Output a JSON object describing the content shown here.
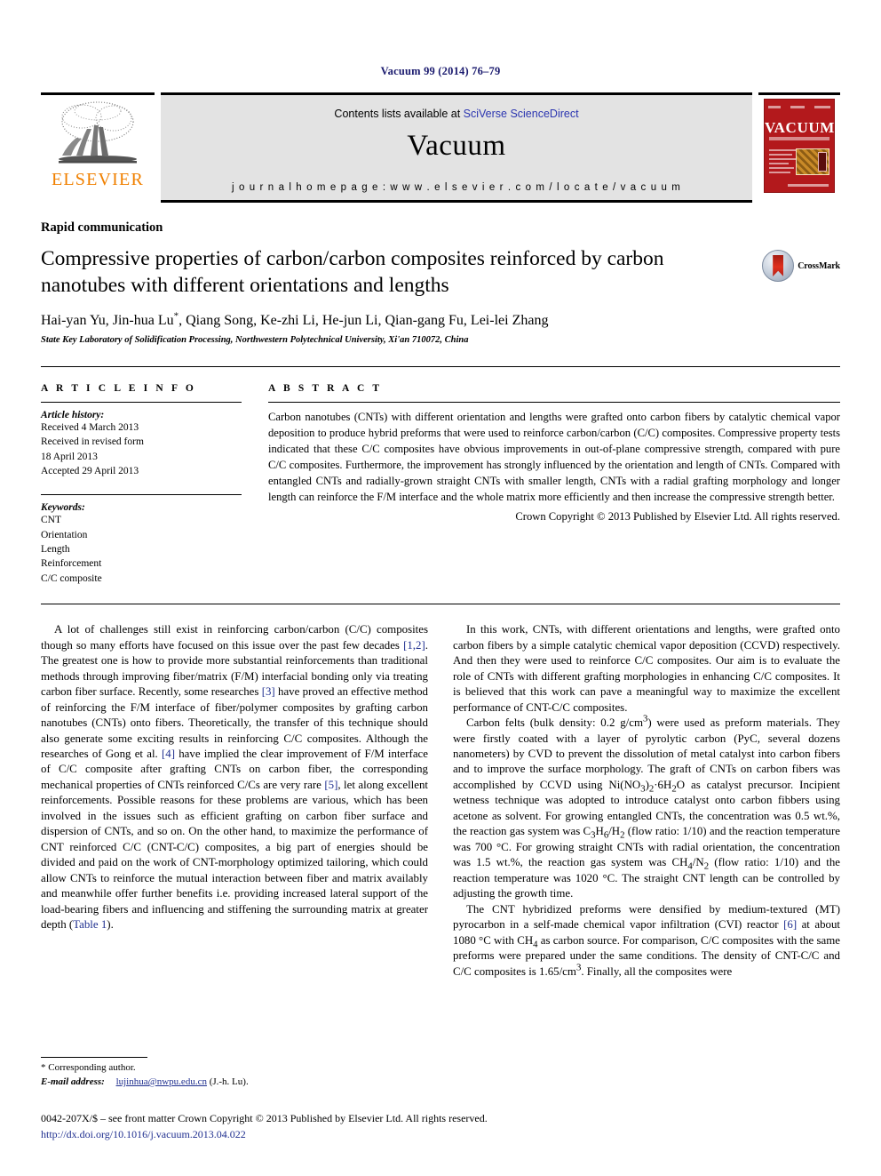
{
  "running_head": "Vacuum 99 (2014) 76–79",
  "masthead": {
    "publisher_name": "ELSEVIER",
    "publisher_logo_name": "elsevier-tree-logo",
    "contents_prefix": "Contents lists available at ",
    "contents_link": "SciVerse ScienceDirect",
    "journal_name": "Vacuum",
    "homepage_label": "j o u r n a l   h o m e p a g e :   w w w . e l s e v i e r . c o m / l o c a t e / v a c u u m",
    "cover": {
      "title": "VACUUM",
      "accent_color": "#b3191c"
    }
  },
  "article": {
    "section_type": "Rapid communication",
    "title": "Compressive properties of carbon/carbon composites reinforced by carbon nanotubes with different orientations and lengths",
    "authors": "Hai-yan Yu, Jin-hua Lu*, Qiang Song, Ke-zhi Li, He-jun Li, Qian-gang Fu, Lei-lei Zhang",
    "affiliation": "State Key Laboratory of Solidification Processing, Northwestern Polytechnical University, Xi'an 710072, China",
    "crossmark_label": "CrossMark"
  },
  "article_info": {
    "heading": "A R T I C L E   I N F O",
    "history_label": "Article history:",
    "history": [
      "Received 4 March 2013",
      "Received in revised form",
      "18 April 2013",
      "Accepted 29 April 2013"
    ],
    "keywords_label": "Keywords:",
    "keywords": [
      "CNT",
      "Orientation",
      "Length",
      "Reinforcement",
      "C/C composite"
    ]
  },
  "abstract": {
    "heading": "A B S T R A C T",
    "text": "Carbon nanotubes (CNTs) with different orientation and lengths were grafted onto carbon fibers by catalytic chemical vapor deposition to produce hybrid preforms that were used to reinforce carbon/carbon (C/C) composites. Compressive property tests indicated that these C/C composites have obvious improvements in out-of-plane compressive strength, compared with pure C/C composites. Furthermore, the improvement has strongly influenced by the orientation and length of CNTs. Compared with entangled CNTs and radially-grown straight CNTs with smaller length, CNTs with a radial grafting morphology and longer length can reinforce the F/M interface and the whole matrix more efficiently and then increase the compressive strength better.",
    "copyright": "Crown Copyright © 2013 Published by Elsevier Ltd. All rights reserved."
  },
  "body": {
    "left_column": [
      "A lot of challenges still exist in reinforcing carbon/carbon (C/C) composites though so many efforts have focused on this issue over the past few decades [1,2]. The greatest one is how to provide more substantial reinforcements than traditional methods through improving fiber/matrix (F/M) interfacial bonding only via treating carbon fiber surface. Recently, some researches [3] have proved an effective method of reinforcing the F/M interface of fiber/polymer composites by grafting carbon nanotubes (CNTs) onto fibers. Theoretically, the transfer of this technique should also generate some exciting results in reinforcing C/C composites. Although the researches of Gong et al. [4] have implied the clear improvement of F/M interface of C/C composite after grafting CNTs on carbon fiber, the corresponding mechanical properties of CNTs reinforced C/Cs are very rare [5], let along excellent reinforcements. Possible reasons for these problems are various, which has been involved in the issues such as efficient grafting on carbon fiber surface and dispersion of CNTs, and so on. On the other hand, to maximize the performance of CNT reinforced C/C (CNT-C/C) composites, a big part of energies should be divided and paid on the work of CNT-morphology optimized tailoring, which could allow CNTs to reinforce the mutual interaction between fiber and matrix availably and meanwhile offer further benefits i.e. providing increased lateral support of the load-bearing fibers and influencing and stiffening the surrounding matrix at greater depth (Table 1)."
    ],
    "right_column": [
      "In this work, CNTs, with different orientations and lengths, were grafted onto carbon fibers by a simple catalytic chemical vapor deposition (CCVD) respectively. And then they were used to reinforce C/C composites. Our aim is to evaluate the role of CNTs with different grafting morphologies in enhancing C/C composites. It is believed that this work can pave a meaningful way to maximize the excellent performance of CNT-C/C composites.",
      "Carbon felts (bulk density: 0.2 g/cm3) were used as preform materials. They were firstly coated with a layer of pyrolytic carbon (PyC, several dozens nanometers) by CVD to prevent the dissolution of metal catalyst into carbon fibers and to improve the surface morphology. The graft of CNTs on carbon fibers was accomplished by CCVD using Ni(NO3)2·6H2O as catalyst precursor. Incipient wetness technique was adopted to introduce catalyst onto carbon fibbers using acetone as solvent. For growing entangled CNTs, the concentration was 0.5 wt.%, the reaction gas system was C3H6/H2 (flow ratio: 1/10) and the reaction temperature was 700 °C. For growing straight CNTs with radial orientation, the concentration was 1.5 wt.%, the reaction gas system was CH4/N2 (flow ratio: 1/10) and the reaction temperature was 1020 °C. The straight CNT length can be controlled by adjusting the growth time.",
      "The CNT hybridized preforms were densified by medium-textured (MT) pyrocarbon in a self-made chemical vapor infiltration (CVI) reactor [6] at about 1080 °C with CH4 as carbon source. For comparison, C/C composites with the same preforms were prepared under the same conditions. The density of CNT-C/C and C/C composites is 1.65/cm3. Finally, all the composites were"
    ]
  },
  "footnote": {
    "corresponding": "* Corresponding author.",
    "email_label": "E-mail address:",
    "email": "lujinhua@nwpu.edu.cn",
    "email_suffix": "(J.-h. Lu)."
  },
  "footer": {
    "issn_line": "0042-207X/$ – see front matter Crown Copyright © 2013 Published by Elsevier Ltd. All rights reserved.",
    "doi": "http://dx.doi.org/10.1016/j.vacuum.2013.04.022"
  }
}
